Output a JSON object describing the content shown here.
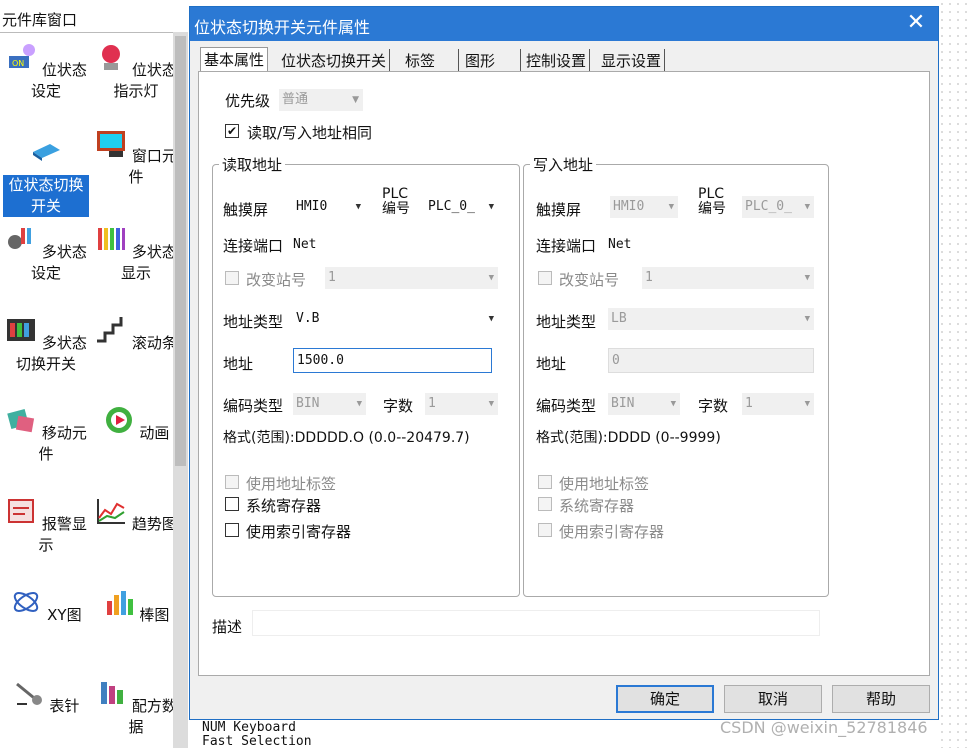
{
  "library": {
    "title": "元件库窗口",
    "items": [
      {
        "label": "位状态设定",
        "icon": "bit-set-icon"
      },
      {
        "label": "位状态指示灯",
        "icon": "indicator-lamp-icon"
      },
      {
        "label": "位状态切换开关",
        "icon": "toggle-switch-icon",
        "selected": true
      },
      {
        "label": "窗口元件",
        "icon": "window-element-icon"
      },
      {
        "label": "多状态设定",
        "icon": "multistate-set-icon"
      },
      {
        "label": "多状态显示",
        "icon": "multistate-display-icon"
      },
      {
        "label": "多状态切换开关",
        "icon": "multistate-switch-icon"
      },
      {
        "label": "滚动条",
        "icon": "scrollbar-icon"
      },
      {
        "label": "移动元件",
        "icon": "move-element-icon"
      },
      {
        "label": "动画",
        "icon": "animation-icon"
      },
      {
        "label": "报警显示",
        "icon": "alarm-display-icon"
      },
      {
        "label": "趋势图",
        "icon": "trend-chart-icon"
      },
      {
        "label": "XY图",
        "icon": "xy-chart-icon"
      },
      {
        "label": "棒图",
        "icon": "bar-chart-icon"
      },
      {
        "label": "表针",
        "icon": "gauge-needle-icon"
      },
      {
        "label": "配方数据",
        "icon": "recipe-data-icon"
      }
    ]
  },
  "dialog": {
    "title": "位状态切换开关元件属性",
    "close": "✕",
    "tabs": [
      "基本属性",
      "位状态切换开关",
      "标签",
      "图形",
      "控制设置",
      "显示设置"
    ],
    "active_tab": 0,
    "priority": {
      "label": "优先级",
      "value": "普通"
    },
    "same_address": {
      "label": "读取/写入地址相同",
      "checked": true
    },
    "read": {
      "title": "读取地址",
      "screen_label": "触摸屏",
      "screen_value": "HMI0",
      "plc_label_1": "PLC",
      "plc_label_2": "编号",
      "plc_value": "PLC_0_",
      "port_label": "连接端口",
      "port_value": "Net",
      "change_station": "改变站号",
      "station_value": "1",
      "addr_type_label": "地址类型",
      "addr_type_value": "V.B",
      "addr_label": "地址",
      "addr_value": "1500.0",
      "code_label": "编码类型",
      "code_value": "BIN",
      "words_label": "字数",
      "words_value": "1",
      "format": "格式(范围):DDDDD.O (0.0--20479.7)",
      "use_tag": "使用地址标签",
      "sys_reg": "系统寄存器",
      "index_reg": "使用索引寄存器"
    },
    "write": {
      "title": "写入地址",
      "screen_label": "触摸屏",
      "screen_value": "HMI0",
      "plc_label_1": "PLC",
      "plc_label_2": "编号",
      "plc_value": "PLC_0_",
      "port_label": "连接端口",
      "port_value": "Net",
      "change_station": "改变站号",
      "station_value": "1",
      "addr_type_label": "地址类型",
      "addr_type_value": "LB",
      "addr_label": "地址",
      "addr_value": "0",
      "code_label": "编码类型",
      "code_value": "BIN",
      "words_label": "字数",
      "words_value": "1",
      "format": "格式(范围):DDDD (0--9999)",
      "use_tag": "使用地址标签",
      "sys_reg": "系统寄存器",
      "index_reg": "使用索引寄存器"
    },
    "desc_label": "描述",
    "buttons": {
      "ok": "确定",
      "cancel": "取消",
      "help": "帮助"
    }
  },
  "status_lines": [
    "NUM Keyboard",
    "Fast Selection"
  ],
  "watermark": "CSDN @weixin_52781846",
  "colors": {
    "accent": "#2b79d4",
    "selected": "#1d6fd1"
  }
}
